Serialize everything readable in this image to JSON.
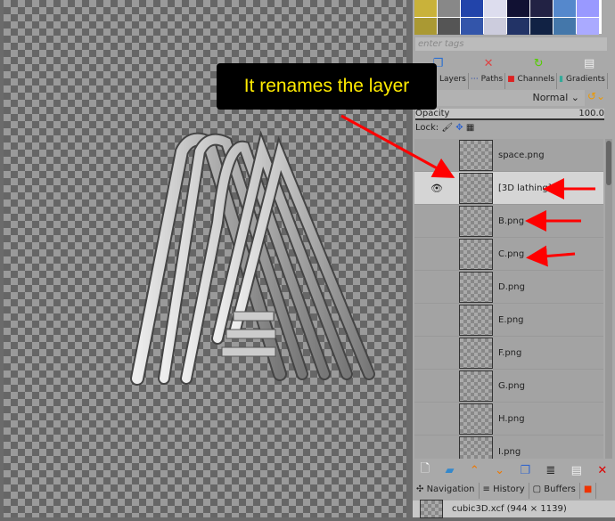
{
  "callout": {
    "text": "It renames the layer"
  },
  "tags": {
    "placeholder": "enter tags"
  },
  "tabs": [
    {
      "label": "Layers",
      "shown": "yers"
    },
    {
      "label": "Paths"
    },
    {
      "label": "Channels"
    },
    {
      "label": "Gradients"
    }
  ],
  "mode": {
    "value": "Normal"
  },
  "opacity": {
    "label": "Opacity",
    "value": "100.0"
  },
  "lock": {
    "label": "Lock:"
  },
  "layers": [
    {
      "name": "space.png"
    },
    {
      "name": "[3D lathing]",
      "selected": true,
      "visible": true
    },
    {
      "name": "B.png"
    },
    {
      "name": "C.png"
    },
    {
      "name": "D.png"
    },
    {
      "name": "E.png"
    },
    {
      "name": "F.png"
    },
    {
      "name": "G.png"
    },
    {
      "name": "H.png"
    },
    {
      "name": "I.png"
    }
  ],
  "bottom_tabs": [
    {
      "label": "Navigation"
    },
    {
      "label": "History"
    },
    {
      "label": "Buffers"
    }
  ],
  "document": {
    "title": "cubic3D.xcf (944 × 1139)"
  },
  "colors": {
    "callout_text": "#ffeb00",
    "arrow": "#ff0000"
  }
}
